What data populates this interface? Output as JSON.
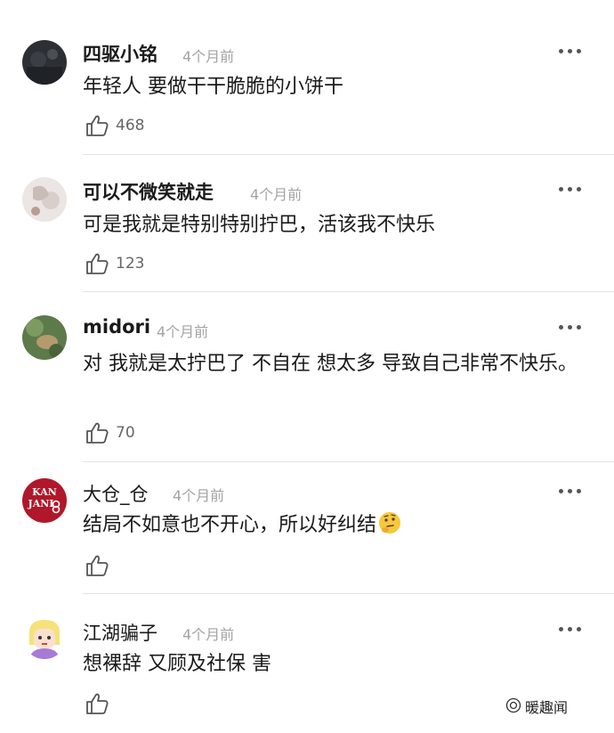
{
  "comments": [
    {
      "username": "四驱小铭",
      "time": "4个月前",
      "text": "年轻人 要做干干脆脆的小饼干",
      "likes": "468",
      "avatar": "dark-photo-avatar"
    },
    {
      "username": "可以不微笑就走",
      "time": "4个月前",
      "text": "可是我就是特别特别拧巴，活该我不快乐",
      "likes": "123",
      "avatar": "light-photo-avatar"
    },
    {
      "username": "midori",
      "time": "4个月前",
      "text": "对 我就是太拧巴了 不自在 想太多 导致自己非常不快乐。",
      "likes": "70",
      "avatar": "green-photo-avatar"
    },
    {
      "username": "大仓_仓",
      "time": "4个月前",
      "text": "结局不如意也不开心，所以好纠结",
      "likes": "",
      "avatar": "kanjani-logo-avatar",
      "emoji": "thinking-face-emoji"
    },
    {
      "username": "江湖骗子",
      "time": "4个月前",
      "text": "想裸辞 又顾及社保 害",
      "likes": "",
      "avatar": "cartoon-avatar"
    }
  ],
  "avatar_logo_text": [
    "KAN",
    "JANI"
  ],
  "watermark": "暖趣闻",
  "colors": {
    "text": "#1a1a1a",
    "meta": "#a3a3a3",
    "divider": "#e3e3e3",
    "logo_red": "#b0172a"
  }
}
